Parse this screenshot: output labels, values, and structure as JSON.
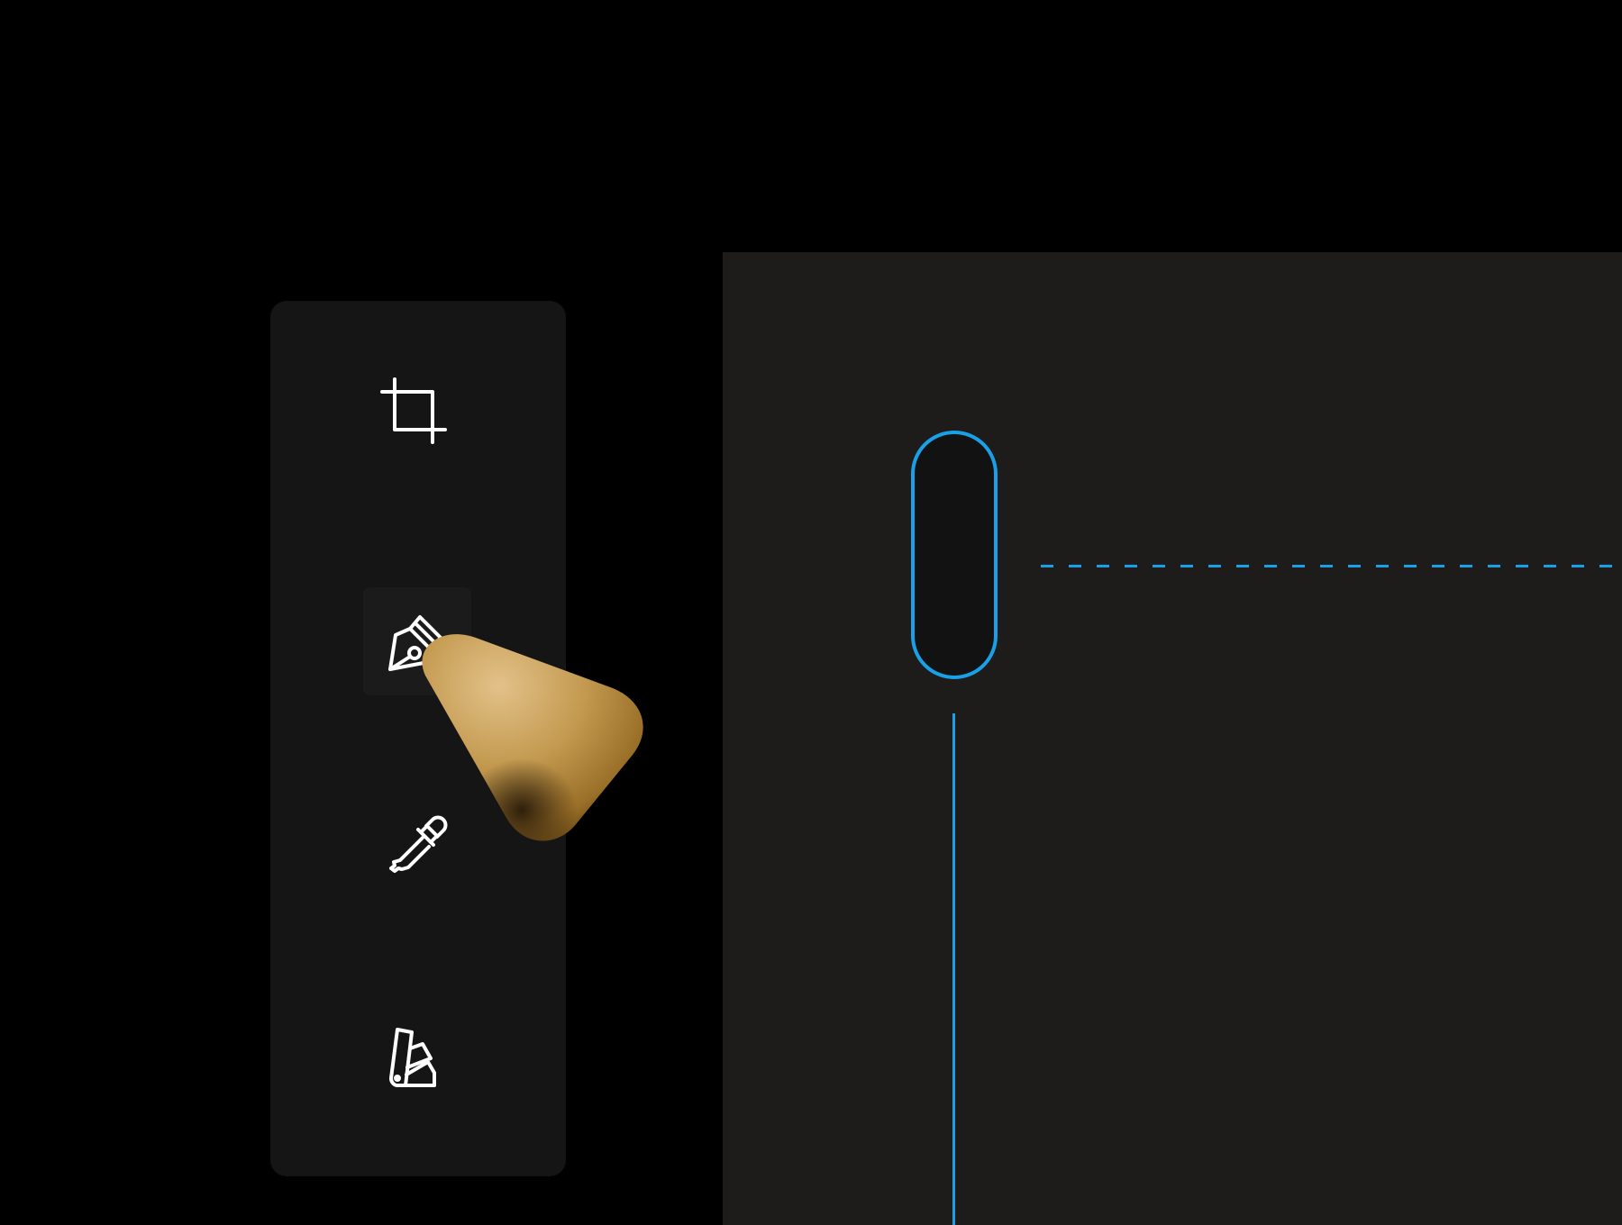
{
  "colors": {
    "page_background": "#000000",
    "toolbar_background": "#151515",
    "selected_tool_background": "#1b1b1b",
    "canvas_background": "#1d1c1a",
    "guide_accent": "#1aa0e6",
    "icon_stroke": "#ffffff",
    "pointer_gold": "#b68c3f"
  },
  "toolbar": {
    "tools": [
      {
        "icon": "crop-icon",
        "selected": false
      },
      {
        "icon": "pen-tool-icon",
        "selected": true
      },
      {
        "icon": "eyedropper-icon",
        "selected": false
      },
      {
        "icon": "color-swatch-icon",
        "selected": false
      }
    ]
  },
  "canvas": {
    "guides": [
      "horizontal-dashed",
      "vertical-solid"
    ]
  }
}
